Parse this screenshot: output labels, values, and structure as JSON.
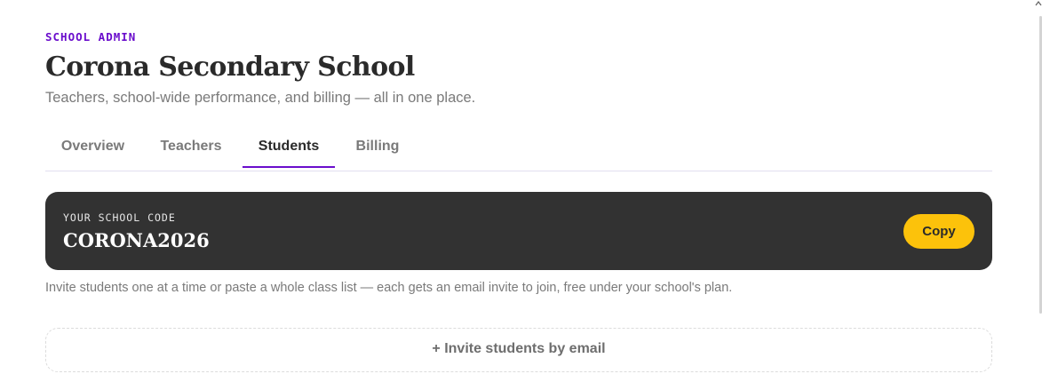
{
  "header": {
    "eyebrow": "SCHOOL ADMIN",
    "title": "Corona Secondary School",
    "subtitle": "Teachers, school-wide performance, and billing — all in one place."
  },
  "tabs": [
    {
      "label": "Overview",
      "active": false
    },
    {
      "label": "Teachers",
      "active": false
    },
    {
      "label": "Students",
      "active": true
    },
    {
      "label": "Billing",
      "active": false
    }
  ],
  "school_code": {
    "label": "YOUR SCHOOL CODE",
    "value": "CORONA2026",
    "copy_label": "Copy"
  },
  "hint": "Invite students one at a time or paste a whole class list — each gets an email invite to join, free under your school's plan.",
  "invite_button": "+ Invite students by email",
  "colors": {
    "accent": "#6a0dcc",
    "card_bg": "#323232",
    "copy_button": "#fcc20b",
    "muted_text": "#7a7a7a"
  },
  "icons": {
    "scroll_up": "chevron-up-icon"
  }
}
